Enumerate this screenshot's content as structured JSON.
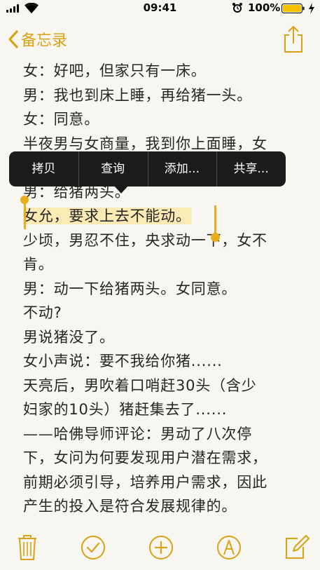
{
  "status_bar": {
    "time": "09:41",
    "battery_percent": "100%",
    "battery_level": 1.0,
    "accent": "#f5c000"
  },
  "nav": {
    "back_label": "备忘录",
    "back_icon": "chevron-left-icon",
    "share_icon": "share-icon",
    "accent": "#d9a217"
  },
  "note": {
    "lines": [
      "女：好吧，但家只有一床。",
      "男：我也到床上睡，再给猪一头。",
      "女：同意。",
      "半夜男与女商量，我到你上面睡，女",
      "",
      "男：给猪两头。",
      "女允，要求上去不能动。",
      "少顷，男忍不住，央求动一下，女不",
      "肯。",
      "男：动一下给猪两头。女同意。",
      "不动?",
      "男说猪没了。",
      "女小声说：要不我给你猪......",
      "天亮后，男吹着口哨赶30头（含少",
      "妇家的10头）猪赶集去了......",
      "——哈佛导师评论：男动了八次停",
      "下，女问为何要发现用户潜在需求，",
      "前期必须引导，培养用户需求，因此",
      "产生的投入是符合发展规律的。"
    ],
    "selection_color": "#fbeab3"
  },
  "edit_menu": {
    "items": [
      "拷贝",
      "查询",
      "添加...",
      "共享..."
    ]
  },
  "toolbar": {
    "icons": [
      "trash-icon",
      "checklist-icon",
      "add-icon",
      "markup-icon",
      "compose-icon"
    ]
  }
}
